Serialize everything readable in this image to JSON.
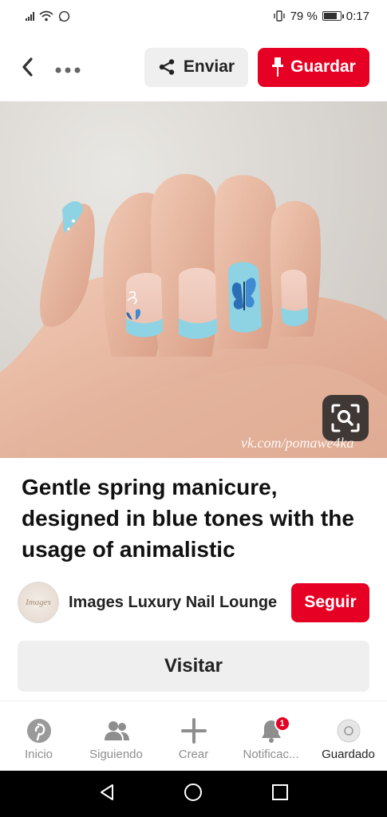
{
  "status_bar": {
    "battery_percent": "79 %",
    "battery_level": 0.79,
    "time": "0:17"
  },
  "top_bar": {
    "send_label": "Enviar",
    "save_label": "Guardar"
  },
  "pin": {
    "image_watermark": "vk.com/pomawe4ka",
    "title": "Gentle spring manicure, designed in blue tones with the usage of animalistic",
    "creator": {
      "avatar_text": "Images",
      "name": "Images Luxury Nail Lounge",
      "follow_label": "Seguir"
    },
    "visit_label": "Visitar"
  },
  "bottom_nav": {
    "items": [
      {
        "label": "Inicio",
        "icon": "pinterest-logo-icon"
      },
      {
        "label": "Siguiendo",
        "icon": "people-icon"
      },
      {
        "label": "Crear",
        "icon": "plus-icon"
      },
      {
        "label": "Notificac...",
        "icon": "bell-icon",
        "badge": "1"
      },
      {
        "label": "Guardado",
        "icon": "profile-icon"
      }
    ],
    "active_index": 4
  },
  "colors": {
    "brand_red": "#e60023",
    "button_gray": "#efefef",
    "text_dark": "#111111"
  }
}
